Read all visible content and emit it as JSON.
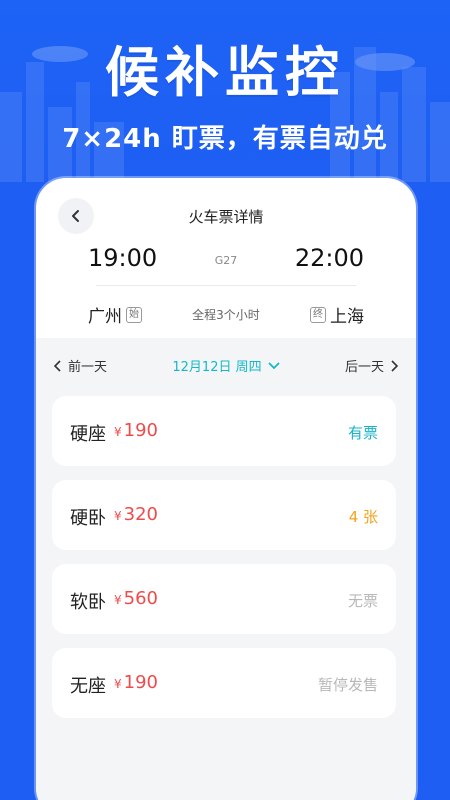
{
  "hero": {
    "title": "候补监控",
    "subtitle": "7×24h 盯票，有票自动兑"
  },
  "header": {
    "title": "火车票详情"
  },
  "trip": {
    "train_no": "G27",
    "depart_time": "19:00",
    "arrive_time": "22:00",
    "from_station": "广州",
    "from_tag": "始",
    "to_station": "上海",
    "to_tag": "终",
    "duration": "全程3个小时"
  },
  "date_bar": {
    "prev_label": "前一天",
    "current_date": "12月12日 周四",
    "next_label": "后一天"
  },
  "seats": [
    {
      "name": "硬座",
      "currency": "¥",
      "price": "190",
      "status": "有票",
      "status_color": "#17b3c6"
    },
    {
      "name": "硬卧",
      "currency": "¥",
      "price": "320",
      "status": "4 张",
      "status_color": "#f2a31b"
    },
    {
      "name": "软卧",
      "currency": "¥",
      "price": "560",
      "status": "无票",
      "status_color": "#b8b8b8"
    },
    {
      "name": "无座",
      "currency": "¥",
      "price": "190",
      "status": "暂停发售",
      "status_color": "#b8b8b8"
    }
  ],
  "colors": {
    "brand_blue": "#1f5ef2",
    "accent_teal": "#13b9c9",
    "price_red": "#ef4b4b"
  }
}
